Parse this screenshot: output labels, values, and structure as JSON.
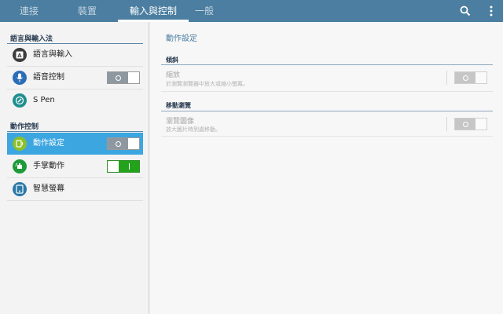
{
  "tabs": [
    {
      "label": "連接",
      "active": false
    },
    {
      "label": "裝置",
      "active": false
    },
    {
      "label": "輸入與控制",
      "active": true
    },
    {
      "label": "一般",
      "active": false
    }
  ],
  "topbar": {
    "search_icon": "search-icon",
    "more_icon": "more-vert-icon",
    "color": "#4b7ea0"
  },
  "sidebar": {
    "sections": [
      {
        "header": "語言與輸入法"
      },
      {
        "header": "動作控制"
      }
    ],
    "items": [
      {
        "label": "語言與輸入",
        "icon": "keyboard-icon",
        "icon_color": "#3d3d3d",
        "toggle": null
      },
      {
        "label": "語音控制",
        "icon": "microphone-icon",
        "icon_color": "#2c6db8",
        "toggle": "off"
      },
      {
        "label": "S Pen",
        "icon": "pen-icon",
        "icon_color": "#1f8f90",
        "toggle": null
      },
      {
        "label": "動作設定",
        "icon": "motion-icon",
        "icon_color": "#8bbf2c",
        "toggle": "off",
        "selected": true
      },
      {
        "label": "手掌動作",
        "icon": "palm-motion-icon",
        "icon_color": "#1e9a3a",
        "toggle": "on"
      },
      {
        "label": "智慧螢幕",
        "icon": "smart-screen-icon",
        "icon_color": "#2a79a8",
        "toggle": null
      }
    ],
    "selected_color": "#3ba6e0"
  },
  "main": {
    "title": "動作設定",
    "sections": [
      {
        "header": "傾斜",
        "title": "縮放",
        "subtitle": "於瀏覽瀏覽器中放大或縮小螢幕。",
        "toggle": "disabled"
      },
      {
        "header": "移動瀏覽",
        "title": "瀏覽圖像",
        "subtitle": "放大圖片時到處移動。",
        "toggle": "disabled"
      }
    ]
  }
}
